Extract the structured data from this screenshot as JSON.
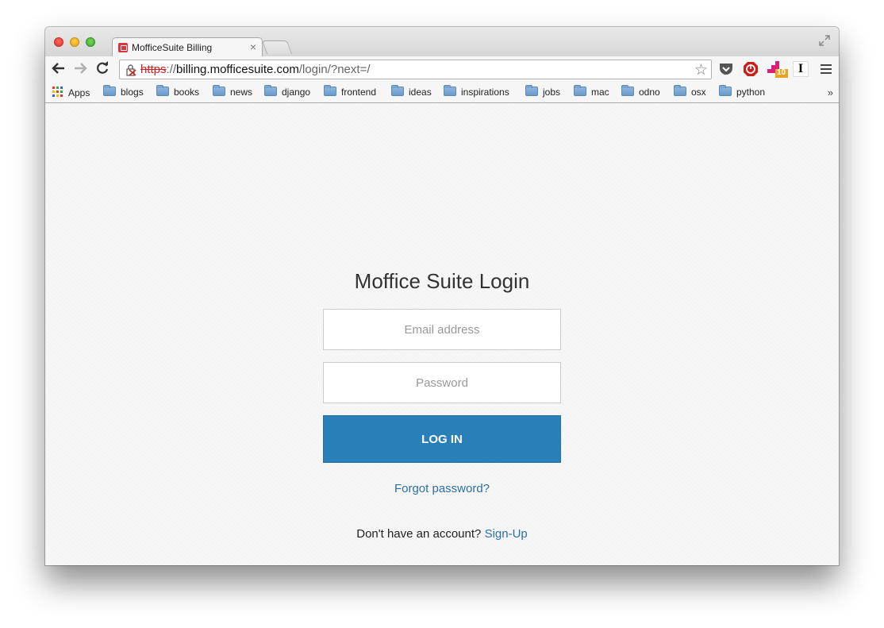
{
  "browser": {
    "tab_title": "MofficeSuite Billing",
    "tab_close": "×",
    "url_scheme": "https",
    "url_sep": "://",
    "url_host": "billing.mofficesuite.com",
    "url_path": "/login/?next=/",
    "bookmarks": {
      "apps": "Apps",
      "folders": [
        "blogs",
        "books",
        "news",
        "django",
        "frontend",
        "ideas",
        "inspirations",
        "jobs",
        "mac",
        "odno",
        "osx",
        "python"
      ],
      "more": "»"
    },
    "extension_badge": "10",
    "extension_letter": "I"
  },
  "login": {
    "title": "Moffice Suite Login",
    "email_placeholder": "Email address",
    "password_placeholder": "Password",
    "submit_label": "LOG IN",
    "forgot_label": "Forgot password?",
    "signup_prompt": "Don't have an account?",
    "signup_label": "Sign-Up"
  },
  "colors": {
    "primary": "#2980b9",
    "link": "#2a6fab"
  }
}
